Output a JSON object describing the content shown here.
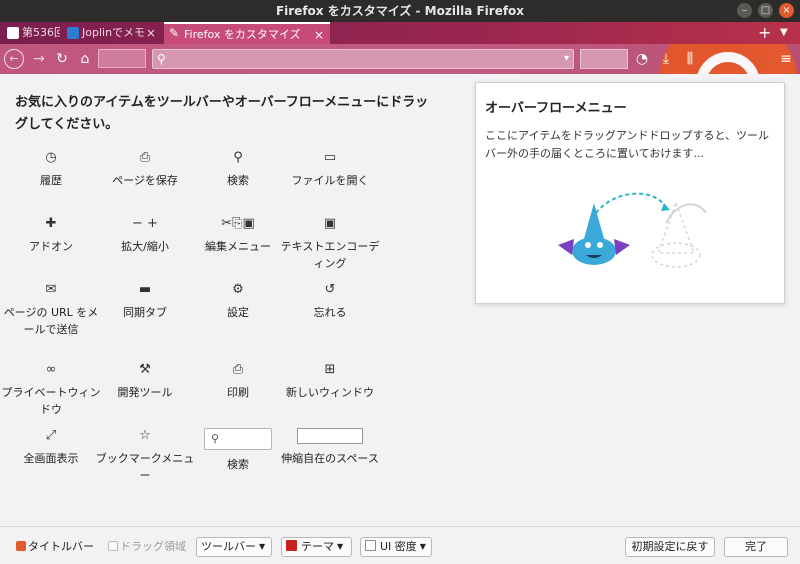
{
  "window": {
    "title": "Firefox をカスタマイズ - Mozilla Firefox"
  },
  "tabs": [
    {
      "label": "第536回"
    },
    {
      "label": "Joplinでメモ"
    },
    {
      "label": "Firefox をカスタマイズ"
    }
  ],
  "customize": {
    "instructions": "お気に入りのアイテムをツールバーやオーバーフローメニューにドラッグしてください。",
    "palette": [
      {
        "icon": "clock-icon",
        "glyph": "◷",
        "label": "履歴"
      },
      {
        "icon": "save-page-icon",
        "glyph": "⎙",
        "label": "ページを保存"
      },
      {
        "icon": "search-icon",
        "glyph": "⚲",
        "label": "検索"
      },
      {
        "icon": "folder-open-icon",
        "glyph": "▭",
        "label": "ファイルを開く"
      },
      {
        "icon": "puzzle-icon",
        "glyph": "✚",
        "label": "アドオン"
      },
      {
        "icon": "zoom-icon",
        "glyph": "− +",
        "label": "拡大/縮小"
      },
      {
        "icon": "edit-icon",
        "glyph": "✂⎘▣",
        "label": "編集メニュー"
      },
      {
        "icon": "text-encoding-icon",
        "glyph": "▣",
        "label": "テキストエンコーディング"
      },
      {
        "icon": "mail-icon",
        "glyph": "✉",
        "label": "ページの URL をメールで送信"
      },
      {
        "icon": "laptop-icon",
        "glyph": "▬",
        "label": "同期タブ"
      },
      {
        "icon": "gear-icon",
        "glyph": "⚙",
        "label": "設定"
      },
      {
        "icon": "forget-icon",
        "glyph": "↺",
        "label": "忘れる"
      },
      {
        "icon": "mask-icon",
        "glyph": "∞",
        "label": "プライベートウィンドウ"
      },
      {
        "icon": "wrench-icon",
        "glyph": "⚒",
        "label": "開発ツール"
      },
      {
        "icon": "printer-icon",
        "glyph": "⎙",
        "label": "印刷"
      },
      {
        "icon": "new-window-icon",
        "glyph": "⊞",
        "label": "新しいウィンドウ"
      },
      {
        "icon": "fullscreen-icon",
        "glyph": "⤢",
        "label": "全画面表示"
      },
      {
        "icon": "bookmark-menu-icon",
        "glyph": "☆",
        "label": "ブックマークメニュー"
      },
      {
        "icon": "search-widget",
        "glyph": "⚲",
        "label": "検索"
      },
      {
        "icon": "flexible-space-widget",
        "glyph": "",
        "label": "伸縮自在のスペース"
      }
    ]
  },
  "overflow_panel": {
    "title": "オーバーフローメニュー",
    "description": "ここにアイテムをドラッグアンドドロップすると、ツールバー外の手の届くところに置いておけます..."
  },
  "footer": {
    "titlebar_label": "タイトルバー",
    "drag_space_label": "ドラッグ領域",
    "toolbars_label": "ツールバー",
    "themes_label": "テーマ",
    "density_label": "UI 密度",
    "restore_label": "初期設定に戻す",
    "done_label": "完了"
  },
  "colors": {
    "accent": "#e05a2b",
    "tabstrip": "#9a2650",
    "navbar": "#c0567f",
    "mascot": "#3aa8d8"
  }
}
